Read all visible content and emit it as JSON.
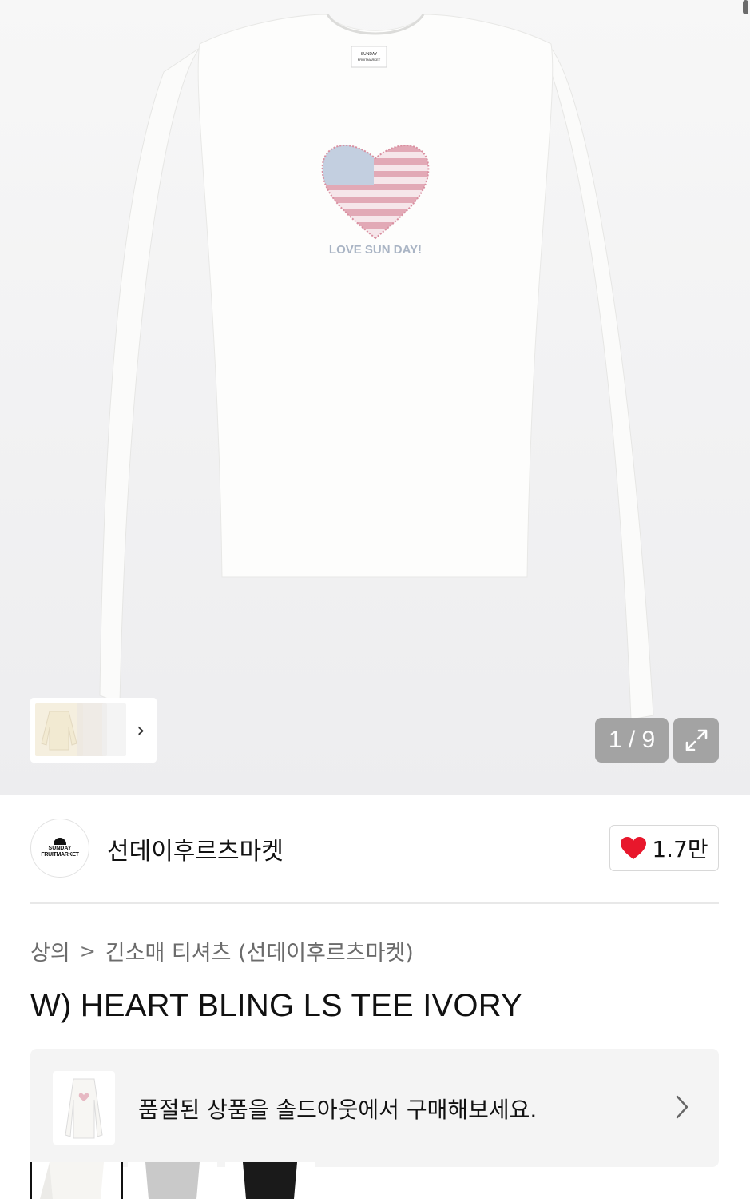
{
  "gallery": {
    "print_text": "LOVE SUN DAY!",
    "label_line1": "SUNDAY",
    "label_line2": "FRUITMARKET",
    "counter": "1 / 9"
  },
  "brand": {
    "logo_line1": "SUNDAY",
    "logo_line2": "FRUITMARKET",
    "name": "선데이후르츠마켓",
    "likes": "1.7만",
    "heart_color": "#e8172c"
  },
  "breadcrumb": {
    "category": "상의",
    "subcategory": "긴소매 티셔츠 (선데이후르츠마켓)"
  },
  "product": {
    "title": "W) HEART BLING LS TEE IVORY"
  },
  "soldout_banner": {
    "message": "품절된 상품을 솔드아웃에서 구매해보세요."
  },
  "icons": {
    "chevron_right": "chevron-right-icon",
    "expand": "expand-icon",
    "heart": "heart-icon"
  }
}
